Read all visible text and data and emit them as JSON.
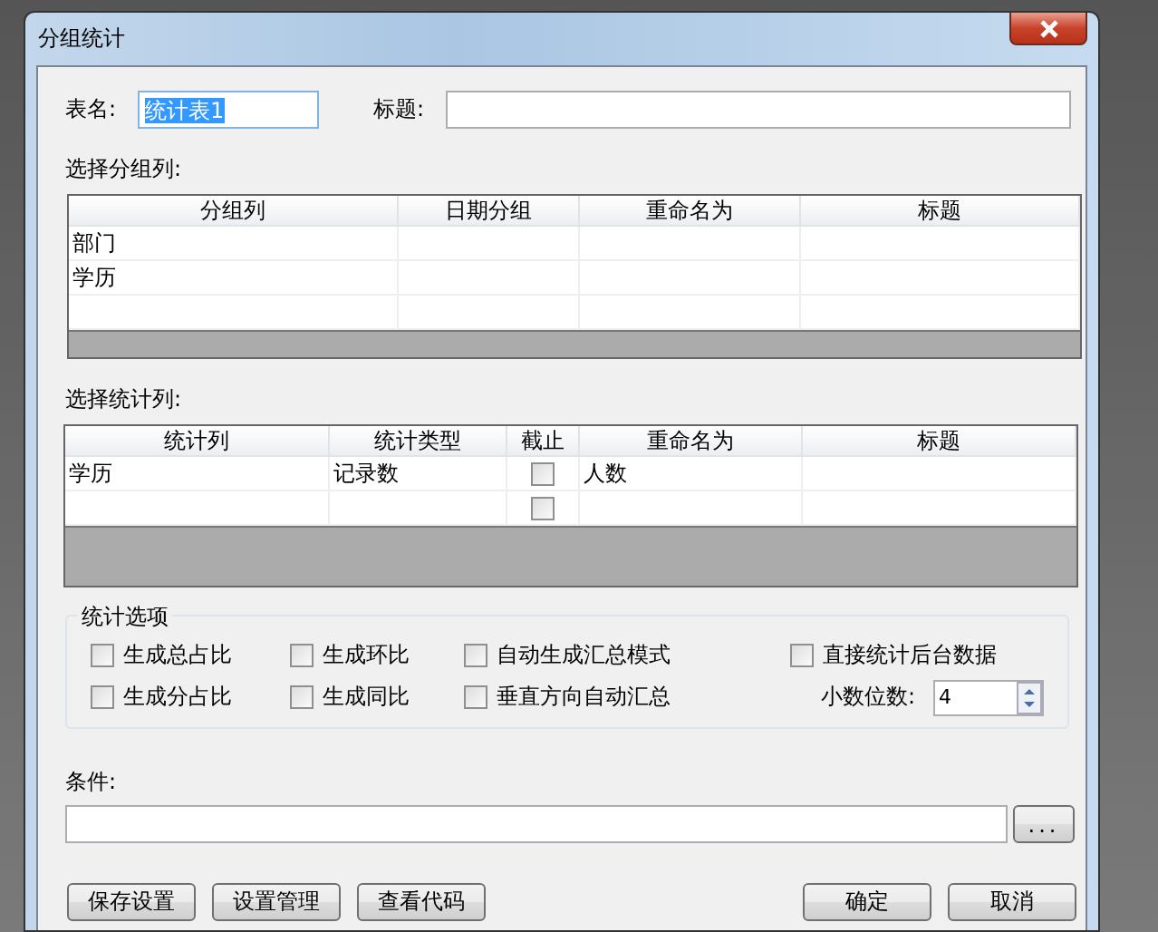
{
  "window": {
    "title": "分组统计"
  },
  "table_name": {
    "label": "表名:",
    "value": "统计表1",
    "selected": true
  },
  "title_field": {
    "label": "标题:"
  },
  "group_section": {
    "label": "选择分组列:",
    "columns": [
      "分组列",
      "日期分组",
      "重命名为",
      "标题"
    ],
    "rows": [
      [
        "部门",
        "",
        "",
        ""
      ],
      [
        "学历",
        "",
        "",
        ""
      ],
      [
        "",
        "",
        "",
        ""
      ]
    ]
  },
  "stat_section": {
    "label": "选择统计列:",
    "columns": [
      "统计列",
      "统计类型",
      "截止",
      "重命名为",
      "标题"
    ],
    "rows": [
      {
        "column": "学历",
        "type": "记录数",
        "cutoff": false,
        "rename": "人数"
      },
      {
        "column": "",
        "type": "",
        "cutoff": false,
        "rename": ""
      }
    ]
  },
  "options": {
    "label": "统计选项",
    "checkboxes": [
      {
        "label": "生成总占比",
        "checked": false
      },
      {
        "label": "生成环比",
        "checked": false
      },
      {
        "label": "自动生成汇总模式",
        "checked": false
      },
      {
        "label": "生成分占比",
        "checked": false
      },
      {
        "label": "生成同比",
        "checked": false
      },
      {
        "label": "垂直方向自动汇总",
        "checked": false
      }
    ],
    "direct": {
      "label": "直接统计后台数据",
      "checked": false
    },
    "decimals": {
      "label": "小数位数:",
      "value": "4"
    }
  },
  "condition": {
    "label": "条件:",
    "browse": "..."
  },
  "buttons_left": [
    "保存设置",
    "设置管理",
    "查看代码"
  ],
  "buttons_right": [
    "确定",
    "取消"
  ]
}
